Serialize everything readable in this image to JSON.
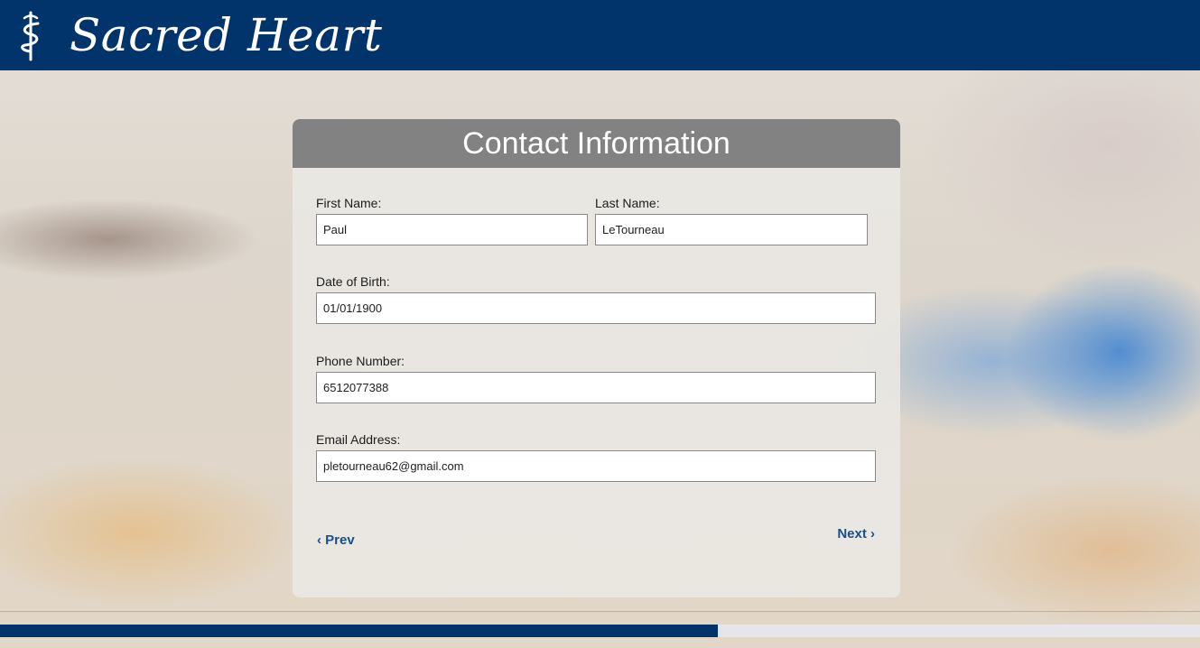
{
  "header": {
    "brand": "Sacred Heart",
    "logo_icon": "caduceus-icon",
    "background": "#00346a"
  },
  "form": {
    "title": "Contact Information",
    "first_name": {
      "label": "First Name:",
      "value": "Paul"
    },
    "last_name": {
      "label": "Last Name:",
      "value": "LeTourneau"
    },
    "dob": {
      "label": "Date of Birth:",
      "value": "01/01/1900"
    },
    "phone": {
      "label": "Phone Number:",
      "value": "6512077388"
    },
    "email": {
      "label": "Email Address:",
      "value": "pletourneau62@gmail.com"
    },
    "prev_label": "‹ Prev",
    "next_label": "Next ›"
  },
  "progress": {
    "fraction": 0.598,
    "color": "#00346a"
  },
  "colors": {
    "accent": "#1a4f8c",
    "card_header": "#828282"
  }
}
